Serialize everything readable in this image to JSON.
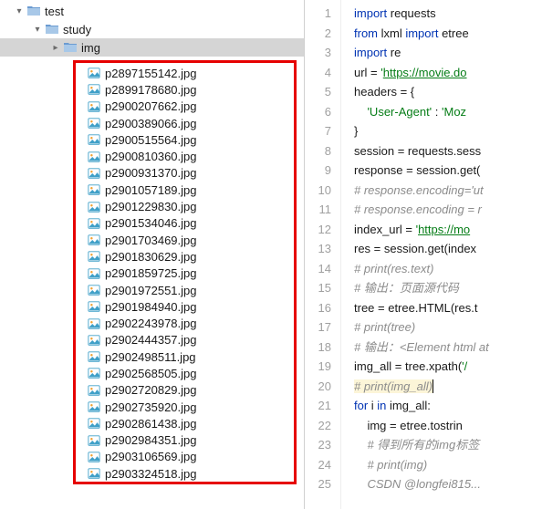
{
  "tree": {
    "root": "test",
    "folder1": "study",
    "folder2": "img",
    "files": [
      "p2897155142.jpg",
      "p2899178680.jpg",
      "p2900207662.jpg",
      "p2900389066.jpg",
      "p2900515564.jpg",
      "p2900810360.jpg",
      "p2900931370.jpg",
      "p2901057189.jpg",
      "p2901229830.jpg",
      "p2901534046.jpg",
      "p2901703469.jpg",
      "p2901830629.jpg",
      "p2901859725.jpg",
      "p2901972551.jpg",
      "p2901984940.jpg",
      "p2902243978.jpg",
      "p2902444357.jpg",
      "p2902498511.jpg",
      "p2902568505.jpg",
      "p2902720829.jpg",
      "p2902735920.jpg",
      "p2902861438.jpg",
      "p2902984351.jpg",
      "p2903106569.jpg",
      "p2903324518.jpg"
    ]
  },
  "code": {
    "lines": [
      {
        "n": 1,
        "html": "<span class='kw'>import</span> requests"
      },
      {
        "n": 2,
        "html": "<span class='kw'>from</span> lxml <span class='kw'>import</span> etree"
      },
      {
        "n": 3,
        "html": "<span class='kw'>import</span> re"
      },
      {
        "n": 4,
        "html": "url = <span class='str'>'</span><span class='url'>https://movie.do</span>"
      },
      {
        "n": 5,
        "html": "headers = {"
      },
      {
        "n": 6,
        "html": "    <span class='str'>'User-Agent'</span> : <span class='str'>'Moz</span>"
      },
      {
        "n": 7,
        "html": "}"
      },
      {
        "n": 8,
        "html": "session = requests.sess"
      },
      {
        "n": 9,
        "html": "response = session.get("
      },
      {
        "n": 10,
        "html": "<span class='com'># response.encoding='ut</span>"
      },
      {
        "n": 11,
        "html": "<span class='com'># response.encoding = r</span>"
      },
      {
        "n": 12,
        "html": "index_url = <span class='str'>'</span><span class='url'>https://mo</span>"
      },
      {
        "n": 13,
        "html": "res = session.get(index"
      },
      {
        "n": 14,
        "html": "<span class='com'># print(res.text)</span>"
      },
      {
        "n": 15,
        "html": "<span class='com'># 输出：页面源代码</span>"
      },
      {
        "n": 16,
        "html": "tree = etree.HTML(res.t"
      },
      {
        "n": 17,
        "html": "<span class='com'># print(tree)</span>"
      },
      {
        "n": 18,
        "html": "<span class='com'># 输出：&lt;Element html at</span>"
      },
      {
        "n": 19,
        "html": "img_all = tree.xpath(<span class='str'>'/</span>"
      },
      {
        "n": 20,
        "html": "<span class='hl'><span class='com'># print(img_all)</span></span><span class='cursor'></span>"
      },
      {
        "n": 21,
        "html": "<span class='kw'>for</span> i <span class='kw'>in</span> img_all:"
      },
      {
        "n": 22,
        "html": "    img = etree.tostrin"
      },
      {
        "n": 23,
        "html": "    <span class='com'># 得到所有的img标签</span>"
      },
      {
        "n": 24,
        "html": "    <span class='com'># print(img)</span>"
      },
      {
        "n": 25,
        "html": "    <span class='com'>CSDN @longfei815...</span>"
      }
    ]
  }
}
